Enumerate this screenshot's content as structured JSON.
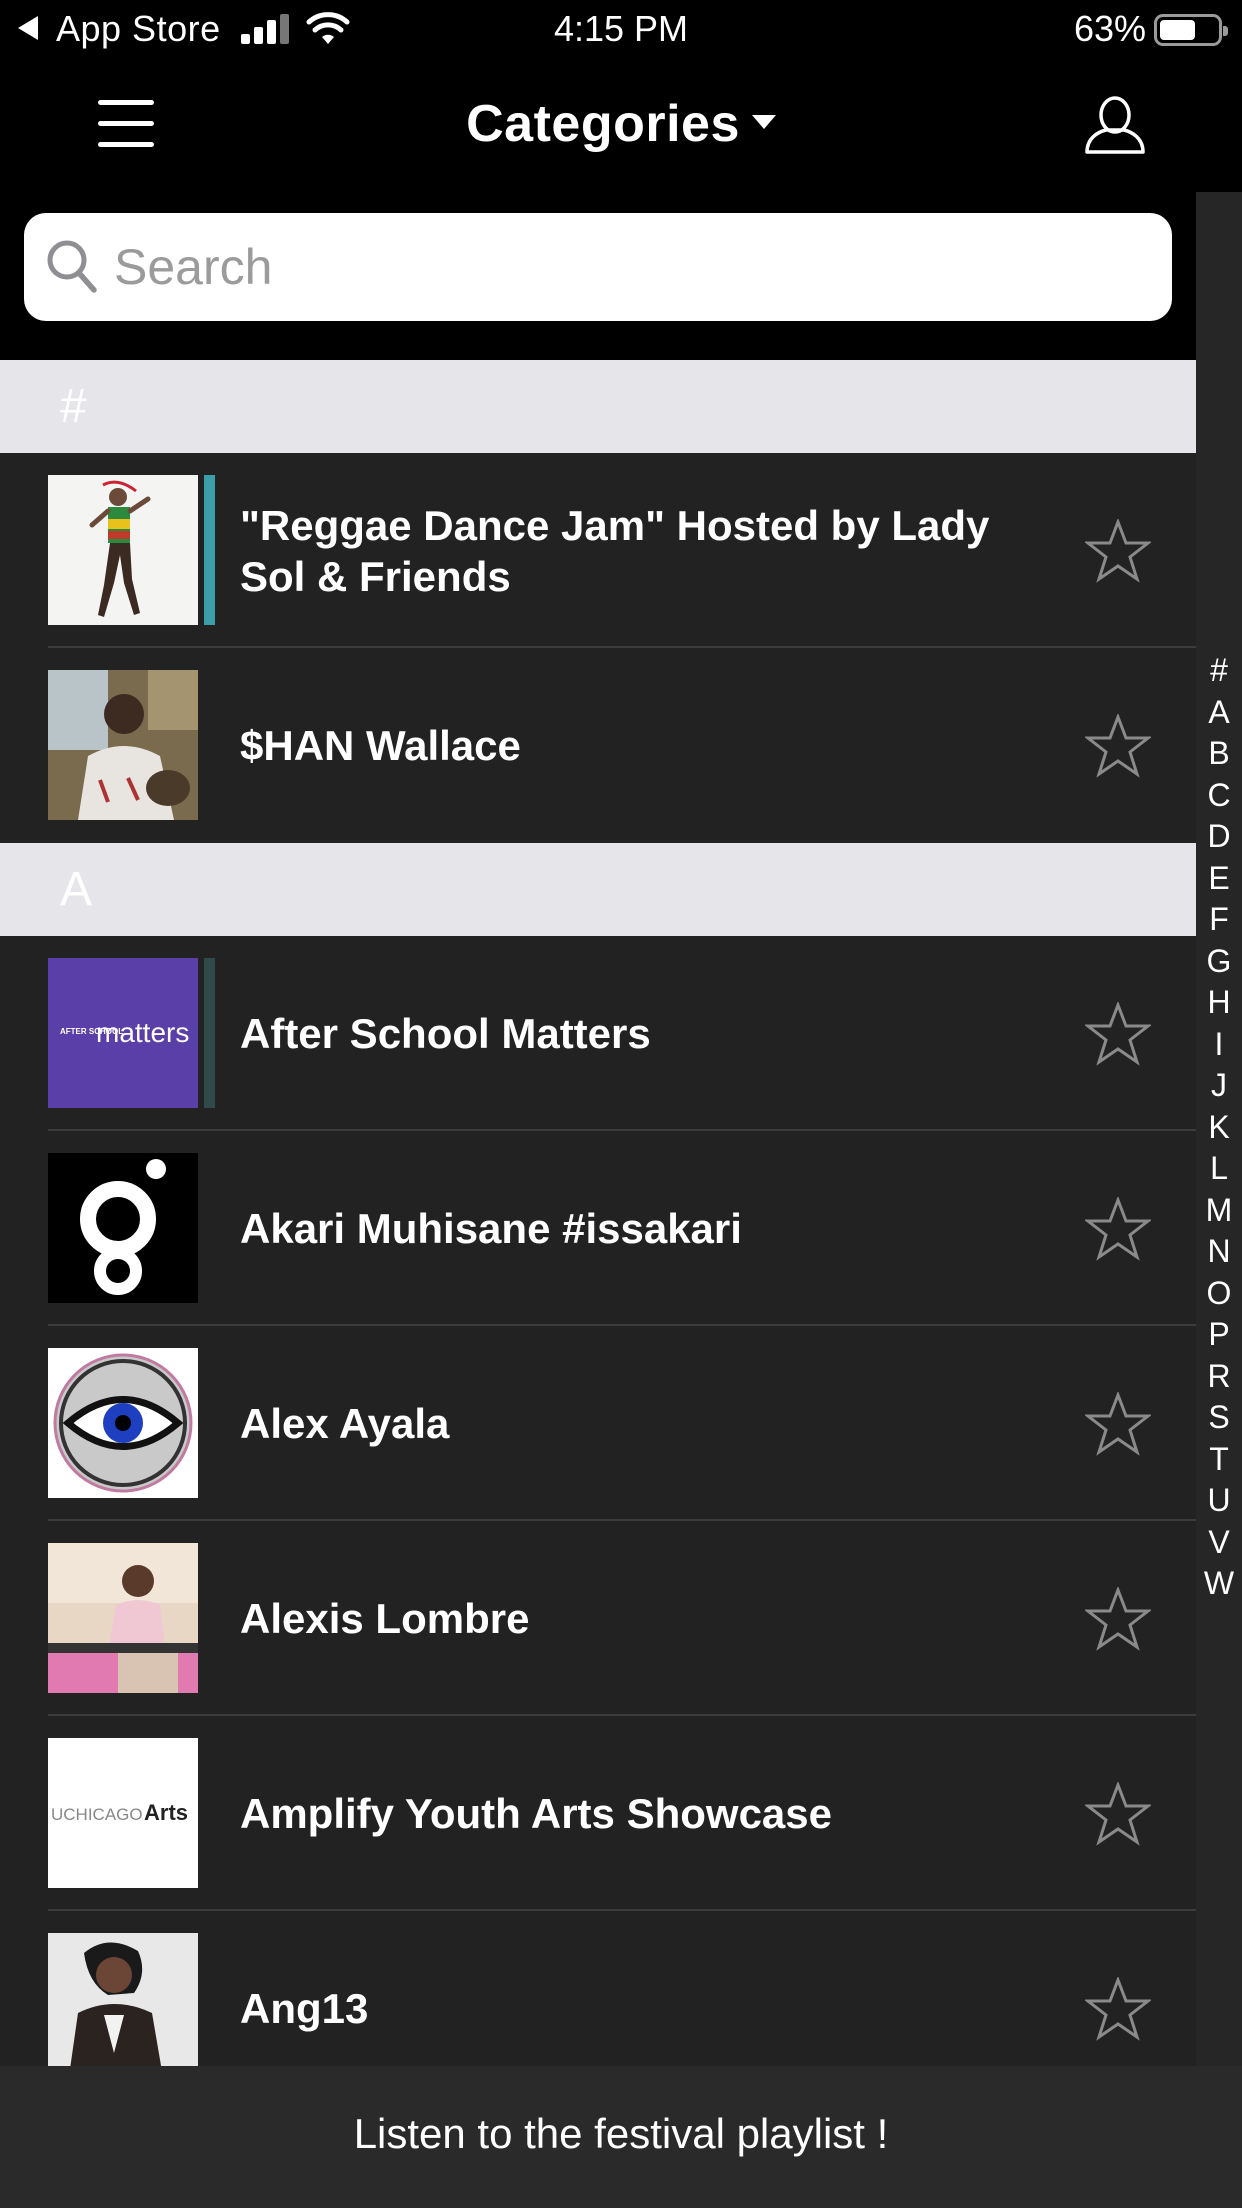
{
  "status_bar": {
    "back_label": "App Store",
    "time": "4:15 PM",
    "battery_percent": "63%",
    "battery_level": 0.63
  },
  "nav": {
    "title": "Categories",
    "menu_icon": "hamburger-menu-icon",
    "profile_icon": "user-profile-icon"
  },
  "search": {
    "placeholder": "Search",
    "value": ""
  },
  "index_letters": [
    "#",
    "A",
    "B",
    "C",
    "D",
    "E",
    "F",
    "G",
    "H",
    "I",
    "J",
    "K",
    "L",
    "M",
    "N",
    "O",
    "P",
    "R",
    "S",
    "T",
    "U",
    "V",
    "W"
  ],
  "sections": [
    {
      "header": "#",
      "items": [
        {
          "title": "\"Reggae Dance Jam\" Hosted by Lady Sol & Friends",
          "accent": "#3a9fa8",
          "favorited": false
        },
        {
          "title": "$HAN Wallace",
          "accent": "",
          "favorited": false
        }
      ]
    },
    {
      "header": "A",
      "items": [
        {
          "title": "After School Matters",
          "accent": "#2f4a48",
          "favorited": false,
          "logo_text": "matters",
          "logo_small": "AFTER SCHOOL"
        },
        {
          "title": "Akari Muhisane #issakari",
          "accent": "",
          "favorited": false
        },
        {
          "title": "Alex Ayala",
          "accent": "",
          "favorited": false
        },
        {
          "title": "Alexis Lombre",
          "accent": "",
          "favorited": false
        },
        {
          "title": "Amplify Youth Arts Showcase",
          "accent": "",
          "favorited": false,
          "logo_text": "UCHICAGO",
          "logo_bold": "Arts"
        },
        {
          "title": "Ang13",
          "accent": "",
          "favorited": false
        }
      ]
    }
  ],
  "bottom_bar": {
    "label": "Listen to the festival playlist !"
  },
  "colors": {
    "background": "#222222",
    "section_header": "#e6e6ea",
    "star_outline": "#8a8a8a"
  }
}
